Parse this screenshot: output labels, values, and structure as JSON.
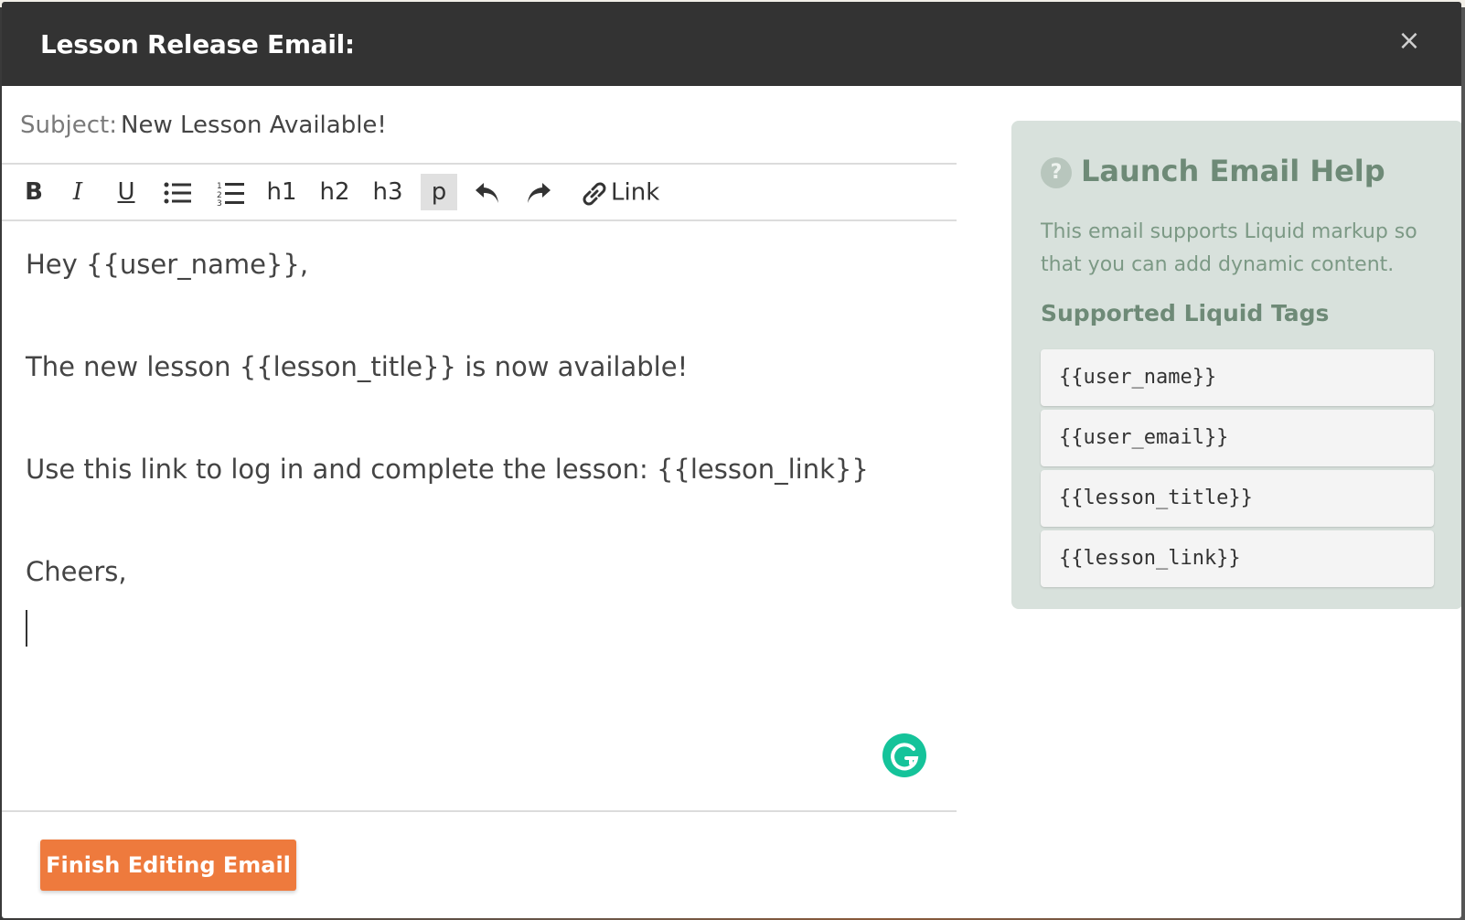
{
  "modal": {
    "title": "Lesson Release Email:",
    "close_icon": "×"
  },
  "subject": {
    "label": "Subject:",
    "value": "New Lesson Available!"
  },
  "toolbar": {
    "bold": "B",
    "italic": "I",
    "underline": "U",
    "h1": "h1",
    "h2": "h2",
    "h3": "h3",
    "p": "p",
    "link": "Link",
    "active_format": "p"
  },
  "editor": {
    "lines": [
      "Hey {{user_name}},",
      "The new lesson {{lesson_title}} is now available!",
      "Use this link to log in and complete the lesson: {{lesson_link}}",
      "Cheers,"
    ]
  },
  "footer": {
    "finish_label": "Finish Editing Email",
    "accent": "#ee7a3d"
  },
  "help": {
    "title": "Launch Email Help",
    "description": "This email supports Liquid markup so that you can add dynamic content.",
    "subtitle": "Supported Liquid Tags",
    "tags": [
      "{{user_name}}",
      "{{user_email}}",
      "{{lesson_title}}",
      "{{lesson_link}}"
    ]
  }
}
